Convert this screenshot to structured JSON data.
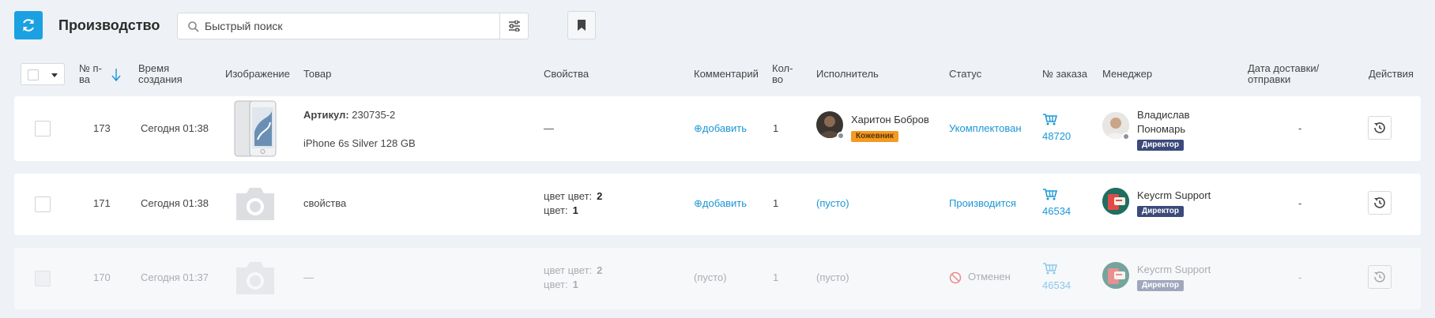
{
  "topbar": {
    "refresh_icon": "refresh-icon",
    "title": "Производство",
    "search_placeholder": "Быстрый поиск",
    "filter_icon": "sliders-icon",
    "bookmark_icon": "bookmark-icon"
  },
  "columns": {
    "num": "№ п-ва",
    "created": "Время создания",
    "image": "Изображение",
    "product": "Товар",
    "props": "Свойства",
    "comment": "Комментарий",
    "qty": "Кол-во",
    "executor": "Исполнитель",
    "status": "Статус",
    "order": "№ заказа",
    "manager": "Менеджер",
    "delivery": "Дата доставки/ отправки",
    "actions": "Действия"
  },
  "rows": [
    {
      "num": "173",
      "created": "Сегодня 01:38",
      "sku_label": "Артикул:",
      "sku": "230735-2",
      "product": "iPhone 6s Silver 128 GB",
      "props": "—",
      "comment": "⊕добавить",
      "qty": "1",
      "executor_name": "Харитон Бобров",
      "executor_role": "Кожевник",
      "status": "Укомплектован",
      "order": "48720",
      "manager_name_1": "Владислав",
      "manager_name_2": "Пономарь",
      "manager_role": "Директор",
      "delivery": "-"
    },
    {
      "num": "171",
      "created": "Сегодня 01:38",
      "product": "свойства",
      "props": [
        {
          "key": "цвет цвет:",
          "val": "2"
        },
        {
          "key": "цвет:",
          "val": "1"
        }
      ],
      "comment": "⊕добавить",
      "qty": "1",
      "executor": "(пусто)",
      "status": "Производится",
      "order": "46534",
      "manager_name": "Keycrm Support",
      "manager_role": "Директор",
      "delivery": "-"
    },
    {
      "num": "170",
      "created": "Сегодня 01:37",
      "product": "—",
      "props": [
        {
          "key": "цвет цвет:",
          "val": "2"
        },
        {
          "key": "цвет:",
          "val": "1"
        }
      ],
      "comment": "(пусто)",
      "qty": "1",
      "executor": "(пусто)",
      "status": "Отменен",
      "order": "46534",
      "manager_name": "Keycrm Support",
      "manager_role": "Директор",
      "delivery": "-"
    }
  ],
  "colors": {
    "accent": "#1ba1e2",
    "link": "#1b95d6",
    "badge_orange": "#f39a26",
    "badge_navy": "#3b4a7a",
    "cancel_red": "#e05a5a"
  }
}
